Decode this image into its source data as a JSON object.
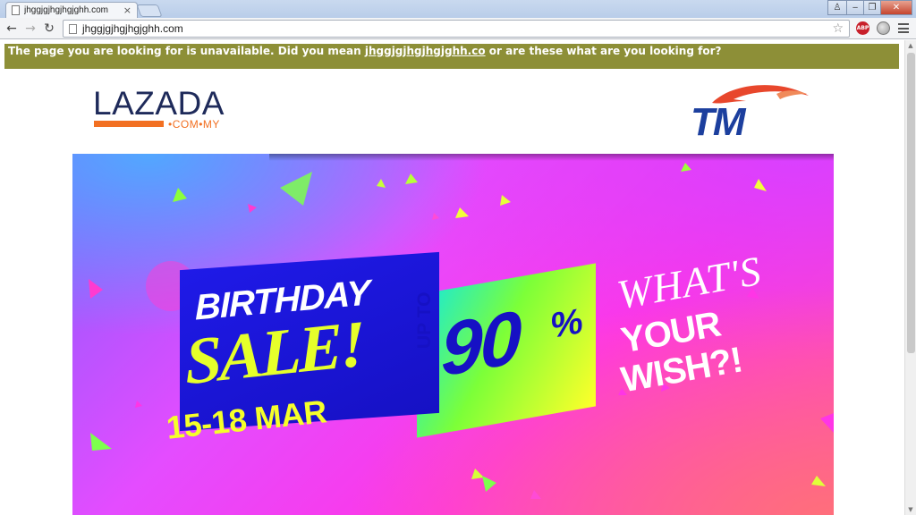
{
  "browser": {
    "tab_title": "jhggjgjhgjhgjghh.com",
    "url": "jhggjgjhgjhgjghh.com"
  },
  "notice": {
    "prefix": "The page you are looking for is unavailable. Did you mean ",
    "suggestion": "jhggjgjhgjhgjghh.co",
    "suffix": " or are these what are you looking for?"
  },
  "lazada_logo": {
    "wordmark": "LAZADA",
    "domain": "•COM•MY",
    "colors": {
      "text": "#1e2a5a",
      "accent": "#f27022"
    }
  },
  "tm_logo": {
    "text": "TM",
    "colors": {
      "text": "#1c3f9e",
      "swoosh": "#e8472c"
    }
  },
  "banner": {
    "line1": "BIRTHDAY",
    "line2": "SALE!",
    "up_to": "UP TO",
    "discount": "90",
    "percent_sign": "%",
    "dates": "15-18 MAR",
    "tagline1": "WHAT'S",
    "tagline2": "YOUR",
    "tagline3": "WISH?!"
  }
}
